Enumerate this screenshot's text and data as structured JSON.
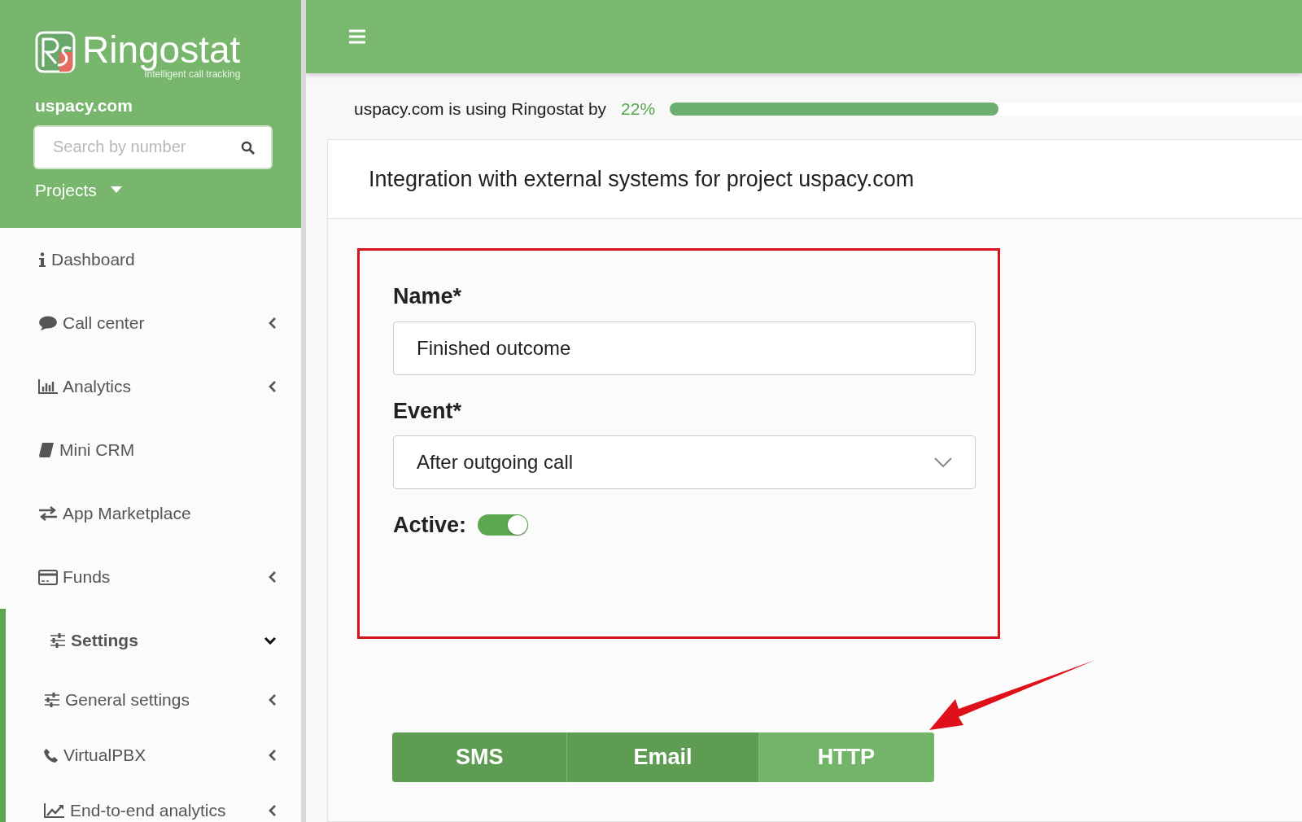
{
  "brand": {
    "name": "Ringostat",
    "tagline": "Intelligent call tracking"
  },
  "project": "uspacy.com",
  "search": {
    "placeholder": "Search by number"
  },
  "projects_menu": {
    "label": "Projects"
  },
  "sidebar": {
    "items": [
      {
        "label": "Dashboard",
        "selected": false
      },
      {
        "label": "Call center",
        "expanded": false,
        "selected": false
      },
      {
        "label": "Analytics",
        "expanded": false,
        "selected": false
      },
      {
        "label": "Mini CRM",
        "selected": false
      },
      {
        "label": "App Marketplace",
        "selected": false
      },
      {
        "label": "Funds",
        "expanded": false,
        "selected": false
      },
      {
        "label": "Settings",
        "expanded": true,
        "selected": true,
        "children": [
          {
            "label": "General settings",
            "expanded": false,
            "selected": false
          },
          {
            "label": "VirtualPBX",
            "expanded": false,
            "selected": false
          },
          {
            "label": "End-to-end analytics",
            "expanded": false,
            "selected": false
          }
        ]
      }
    ]
  },
  "usage": {
    "text": "uspacy.com is using Ringostat by",
    "percent": "22%",
    "level": 0.52
  },
  "page_title": "Integration with external systems for project uspacy.com",
  "form": {
    "name_label": "Name*",
    "name_value": "Finished outcome",
    "event_label": "Event*",
    "event_value": "After outgoing call",
    "active_label": "Active:",
    "active": true
  },
  "tabs": [
    {
      "label": "SMS",
      "selected": false
    },
    {
      "label": "Email",
      "selected": false
    },
    {
      "label": "HTTP",
      "selected": true
    }
  ]
}
